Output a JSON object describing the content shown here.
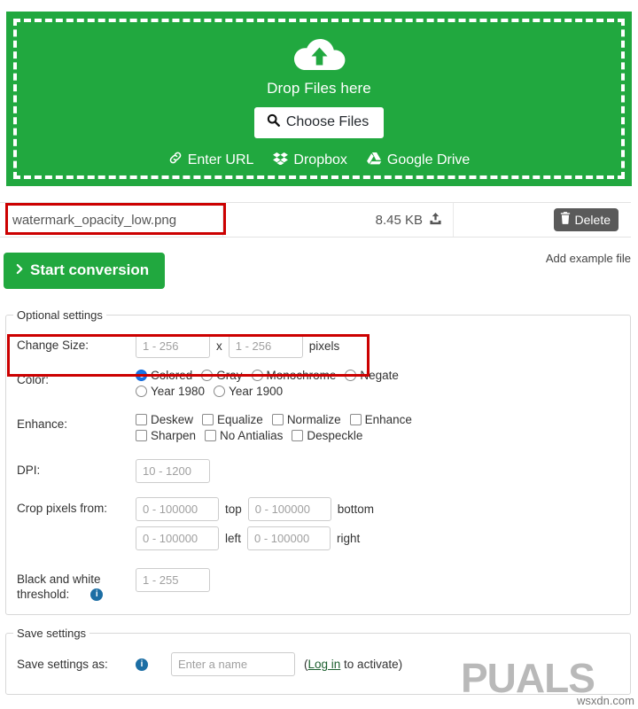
{
  "dropzone": {
    "icon": "cloud-upload-icon",
    "title": "Drop Files here",
    "choose_files_label": "Choose Files",
    "choose_files_icon": "search-icon",
    "sources": [
      {
        "label": "Enter URL",
        "icon": "link-icon"
      },
      {
        "label": "Dropbox",
        "icon": "dropbox-icon"
      },
      {
        "label": "Google Drive",
        "icon": "google-drive-icon"
      }
    ],
    "background_color": "#21a83f"
  },
  "file_row": {
    "filename": "watermark_opacity_low.png",
    "filesize": "8.45 KB",
    "upload_icon": "upload-icon",
    "delete_label": "Delete",
    "delete_icon": "trash-icon"
  },
  "actions": {
    "start_conversion_label": "Start conversion",
    "start_conversion_icon": "chevron-right-icon",
    "add_example_label": "Add example file"
  },
  "optional_settings": {
    "legend": "Optional settings",
    "change_size": {
      "label": "Change Size:",
      "width_placeholder": "1 - 256",
      "width_value": "",
      "separator": "x",
      "height_placeholder": "1 - 256",
      "height_value": "",
      "unit": "pixels"
    },
    "color": {
      "label": "Color:",
      "options": [
        {
          "label": "Colored",
          "checked": true
        },
        {
          "label": "Gray",
          "checked": false
        },
        {
          "label": "Monochrome",
          "checked": false
        },
        {
          "label": "Negate",
          "checked": false
        },
        {
          "label": "Year 1980",
          "checked": false
        },
        {
          "label": "Year 1900",
          "checked": false
        }
      ]
    },
    "enhance": {
      "label": "Enhance:",
      "options": [
        {
          "label": "Deskew",
          "checked": false
        },
        {
          "label": "Equalize",
          "checked": false
        },
        {
          "label": "Normalize",
          "checked": false
        },
        {
          "label": "Enhance",
          "checked": false
        },
        {
          "label": "Sharpen",
          "checked": false
        },
        {
          "label": "No Antialias",
          "checked": false
        },
        {
          "label": "Despeckle",
          "checked": false
        }
      ]
    },
    "dpi": {
      "label": "DPI:",
      "placeholder": "10 - 1200",
      "value": ""
    },
    "crop": {
      "label": "Crop pixels from:",
      "fields": [
        {
          "placeholder": "0 - 100000",
          "value": "",
          "unit": "top"
        },
        {
          "placeholder": "0 - 100000",
          "value": "",
          "unit": "bottom"
        },
        {
          "placeholder": "0 - 100000",
          "value": "",
          "unit": "left"
        },
        {
          "placeholder": "0 - 100000",
          "value": "",
          "unit": "right"
        }
      ]
    },
    "threshold": {
      "label_line1": "Black and white",
      "label_line2": "threshold:",
      "info_icon": "info-icon",
      "placeholder": "1 - 255",
      "value": ""
    }
  },
  "save_settings": {
    "legend": "Save settings",
    "label": "Save settings as:",
    "info_icon": "info-icon",
    "placeholder": "Enter a name",
    "value": "",
    "hint_open": "(",
    "hint_link": "Log in",
    "hint_rest": " to activate)"
  },
  "annotations": {
    "highlight_color": "#cc0000",
    "boxes": [
      "filename-field",
      "change-size-row"
    ]
  },
  "watermark": {
    "brand": "PUALS",
    "source": "wsxdn.com"
  }
}
